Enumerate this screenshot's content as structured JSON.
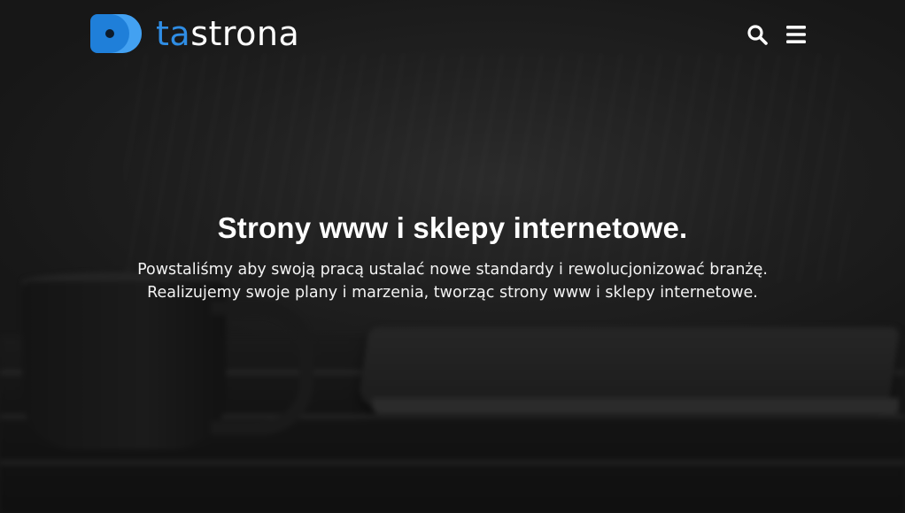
{
  "header": {
    "logo": {
      "text_accent": "ta",
      "text_rest": "strona",
      "accent_color": "#2f8de4"
    },
    "icons": {
      "search": "search-icon",
      "menu": "hamburger-menu-icon"
    }
  },
  "hero": {
    "title": "Strony www i sklepy internetowe.",
    "description_line1": "Powstaliśmy aby swoją pracą ustalać nowe standardy i rewolucjonizować branżę.",
    "description_line2": "Realizujemy swoje plany i marzenia, tworząc strony www i sklepy internetowe."
  },
  "colors": {
    "background": "#1e1e1e",
    "text": "#ffffff",
    "brand": "#2f8de4"
  }
}
